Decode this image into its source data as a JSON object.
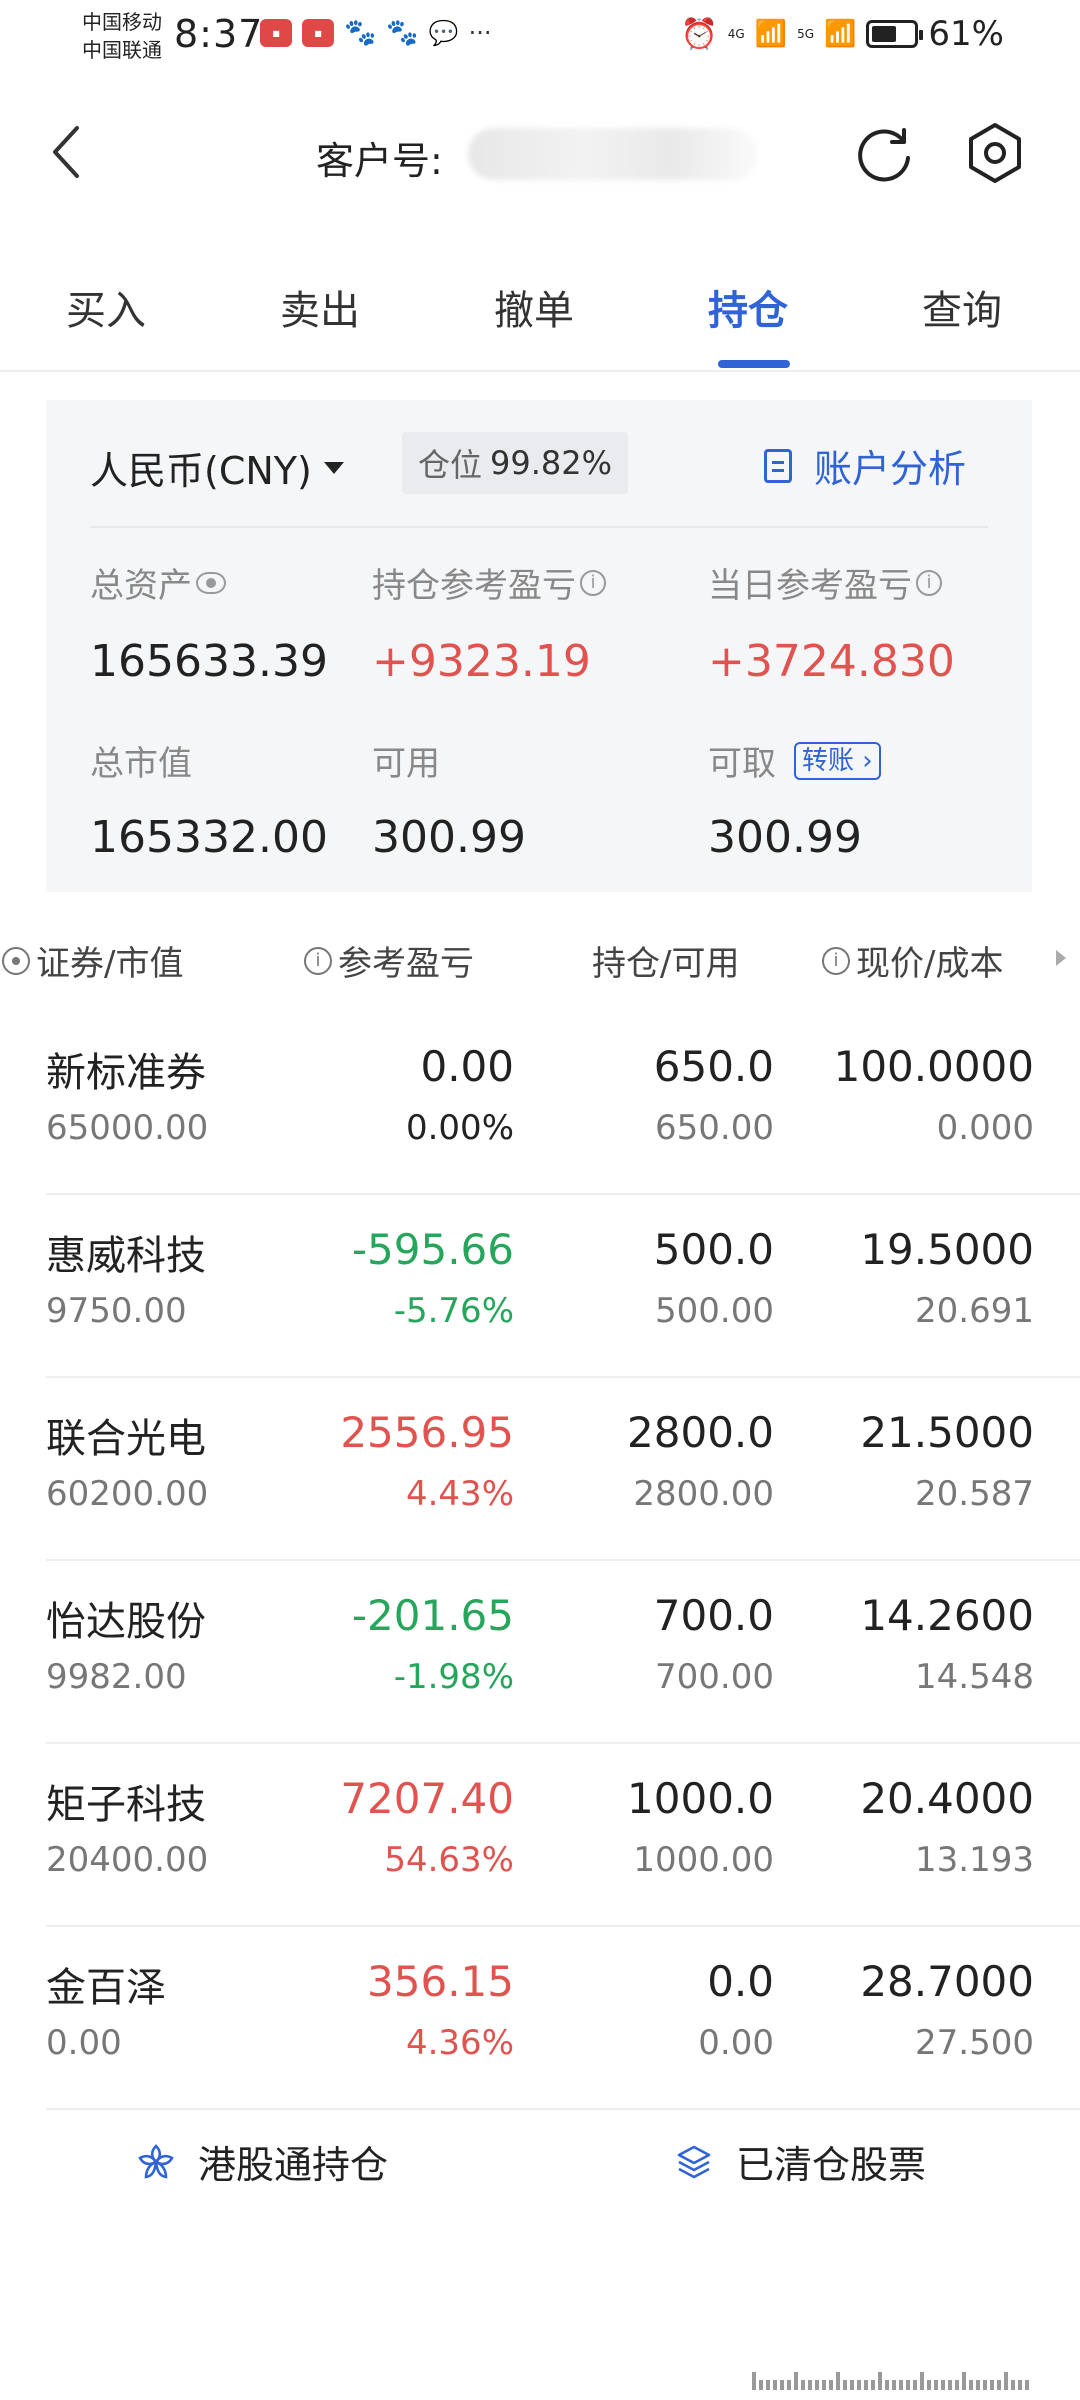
{
  "status_bar": {
    "carrier1": "中国移动",
    "carrier2": "中国联通",
    "time": "8:37",
    "net1": "4G",
    "net2": "5G",
    "battery": "61%",
    "battery_level": 0.61
  },
  "header": {
    "customer_label": "客户号:"
  },
  "tabs": [
    {
      "label": "买入"
    },
    {
      "label": "卖出"
    },
    {
      "label": "撤单"
    },
    {
      "label": "持仓",
      "active": true
    },
    {
      "label": "查询"
    }
  ],
  "summary": {
    "currency": "人民币(CNY)",
    "position_label": "仓位",
    "position_value": "99.82%",
    "analysis_label": "账户分析",
    "total_assets_label": "总资产",
    "total_assets": "165633.39",
    "holding_pl_label": "持仓参考盈亏",
    "holding_pl": "+9323.19",
    "daily_pl_label": "当日参考盈亏",
    "daily_pl": "+3724.830",
    "market_value_label": "总市值",
    "market_value": "165332.00",
    "available_label": "可用",
    "available": "300.99",
    "withdrawable_label": "可取",
    "transfer_label": "转账",
    "withdrawable": "300.99"
  },
  "columns": {
    "security": "证券/市值",
    "pl": "参考盈亏",
    "holding": "持仓/可用",
    "price": "现价/成本"
  },
  "holdings": [
    {
      "name": "新标准券",
      "market_value": "65000.00",
      "pl": "0.00",
      "pl_pct": "0.00%",
      "holding": "650.0",
      "available": "650.00",
      "price": "100.0000",
      "cost": "0.000",
      "trend": "flat"
    },
    {
      "name": "惠威科技",
      "market_value": "9750.00",
      "pl": "-595.66",
      "pl_pct": "-5.76%",
      "holding": "500.0",
      "available": "500.00",
      "price": "19.5000",
      "cost": "20.691",
      "trend": "down"
    },
    {
      "name": "联合光电",
      "market_value": "60200.00",
      "pl": "2556.95",
      "pl_pct": "4.43%",
      "holding": "2800.0",
      "available": "2800.00",
      "price": "21.5000",
      "cost": "20.587",
      "trend": "up"
    },
    {
      "name": "怡达股份",
      "market_value": "9982.00",
      "pl": "-201.65",
      "pl_pct": "-1.98%",
      "holding": "700.0",
      "available": "700.00",
      "price": "14.2600",
      "cost": "14.548",
      "trend": "down"
    },
    {
      "name": "矩子科技",
      "market_value": "20400.00",
      "pl": "7207.40",
      "pl_pct": "54.63%",
      "holding": "1000.0",
      "available": "1000.00",
      "price": "20.4000",
      "cost": "13.193",
      "trend": "up"
    },
    {
      "name": "金百泽",
      "market_value": "0.00",
      "pl": "356.15",
      "pl_pct": "4.36%",
      "holding": "0.0",
      "available": "0.00",
      "price": "28.7000",
      "cost": "27.500",
      "trend": "up"
    }
  ],
  "footer": {
    "hk_holdings": "港股通持仓",
    "cleared_stocks": "已清仓股票"
  },
  "colors": {
    "accent": "#2f63d6",
    "up": "#e0534f",
    "down": "#26a65b"
  }
}
